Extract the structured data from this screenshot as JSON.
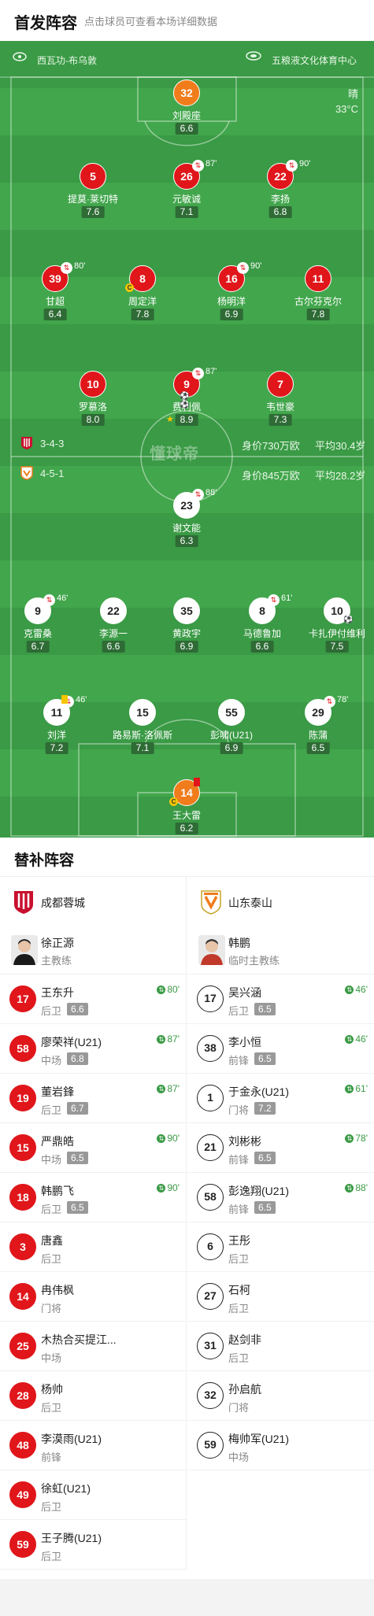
{
  "header": {
    "title": "首发阵容",
    "subtitle": "点击球员可查看本场详细数据"
  },
  "pitch": {
    "home_venue": "西瓦功-布乌敦",
    "away_venue": "五粮液文化体育中心",
    "weather": "晴",
    "temperature": "33°C",
    "watermark": "懂球帝",
    "home_formation": "3-4-3",
    "home_value": "身价730万欧",
    "home_age": "平均30.4岁",
    "away_formation": "4-5-1",
    "away_value": "身价845万欧",
    "away_age": "平均28.2岁"
  },
  "home_lineup": [
    {
      "num": "32",
      "name": "刘殿座",
      "rating": "6.6",
      "color": "o"
    },
    {
      "num": "5",
      "name": "提莫·莱切特",
      "rating": "7.6",
      "color": "r"
    },
    {
      "num": "26",
      "name": "元敏诚",
      "rating": "7.1",
      "color": "r",
      "sub": "87'"
    },
    {
      "num": "22",
      "name": "李扬",
      "rating": "6.8",
      "color": "r",
      "sub": "90'"
    },
    {
      "num": "39",
      "name": "甘超",
      "rating": "6.4",
      "color": "r",
      "sub": "80'"
    },
    {
      "num": "8",
      "name": "周定洋",
      "rating": "7.8",
      "color": "r",
      "captain": "C"
    },
    {
      "num": "16",
      "name": "杨明洋",
      "rating": "6.9",
      "color": "r",
      "sub": "90'"
    },
    {
      "num": "11",
      "name": "古尔芬克尔",
      "rating": "7.8",
      "color": "r"
    },
    {
      "num": "10",
      "name": "罗慕洛",
      "rating": "8.0",
      "color": "r"
    },
    {
      "num": "9",
      "name": "费利佩",
      "rating": "8.9",
      "color": "r",
      "sub": "87'"
    },
    {
      "num": "7",
      "name": "韦世豪",
      "rating": "7.3",
      "color": "r"
    }
  ],
  "away_lineup": [
    {
      "num": "23",
      "name": "谢文能",
      "rating": "6.3",
      "color": "w",
      "sub": "88'"
    },
    {
      "num": "9",
      "name": "克雷桑",
      "rating": "6.7",
      "color": "w",
      "sub": "46'"
    },
    {
      "num": "22",
      "name": "李源一",
      "rating": "6.6",
      "color": "w"
    },
    {
      "num": "35",
      "name": "黄政宇",
      "rating": "6.9",
      "color": "w"
    },
    {
      "num": "8",
      "name": "马德鲁加",
      "rating": "6.6",
      "color": "w",
      "sub": "61'"
    },
    {
      "num": "10",
      "name": "卡扎伊付维利",
      "rating": "7.5",
      "color": "w"
    },
    {
      "num": "11",
      "name": "刘洋",
      "rating": "7.2",
      "color": "w",
      "sub": "46'"
    },
    {
      "num": "15",
      "name": "路易斯·洛佩斯",
      "rating": "7.1",
      "color": "w"
    },
    {
      "num": "55",
      "name": "彭啸(U21)",
      "rating": "6.9",
      "color": "w"
    },
    {
      "num": "29",
      "name": "陈蒲",
      "rating": "6.5",
      "color": "w",
      "sub": "78'"
    },
    {
      "num": "14",
      "name": "王大雷",
      "rating": "6.2",
      "color": "o",
      "captain": "C"
    }
  ],
  "subs_title": "替补阵容",
  "home_team": {
    "name": "成都蓉城",
    "coach_name": "徐正源",
    "coach_role": "主教练",
    "color": "#c8102e"
  },
  "away_team": {
    "name": "山东泰山",
    "coach_name": "韩鹏",
    "coach_role": "临时主教练",
    "color": "#f07c1c"
  },
  "home_subs": [
    {
      "num": "17",
      "name": "王东升",
      "pos": "后卫",
      "rating": "6.6",
      "in": "80'"
    },
    {
      "num": "58",
      "name": "廖荣祥(U21)",
      "pos": "中场",
      "rating": "6.8",
      "in": "87'"
    },
    {
      "num": "19",
      "name": "董岩鋒",
      "pos": "后卫",
      "rating": "6.7",
      "in": "87'"
    },
    {
      "num": "15",
      "name": "严鼎皓",
      "pos": "中场",
      "rating": "6.5",
      "in": "90'"
    },
    {
      "num": "18",
      "name": "韩鹏飞",
      "pos": "后卫",
      "rating": "6.5",
      "in": "90'"
    },
    {
      "num": "3",
      "name": "唐鑫",
      "pos": "后卫"
    },
    {
      "num": "14",
      "name": "冉伟枫",
      "pos": "门将"
    },
    {
      "num": "25",
      "name": "木热合买提江...",
      "pos": "中场"
    },
    {
      "num": "28",
      "name": "杨帅",
      "pos": "后卫"
    },
    {
      "num": "48",
      "name": "李漠雨(U21)",
      "pos": "前锋"
    },
    {
      "num": "49",
      "name": "徐虹(U21)",
      "pos": "后卫"
    },
    {
      "num": "59",
      "name": "王子腾(U21)",
      "pos": "后卫"
    }
  ],
  "away_subs": [
    {
      "num": "17",
      "name": "吴兴涵",
      "pos": "后卫",
      "rating": "6.5",
      "in": "46'"
    },
    {
      "num": "38",
      "name": "李小恒",
      "pos": "前锋",
      "rating": "6.5",
      "in": "46'"
    },
    {
      "num": "1",
      "name": "于金永(U21)",
      "pos": "门将",
      "rating": "7.2",
      "in": "61'"
    },
    {
      "num": "21",
      "name": "刘彬彬",
      "pos": "前锋",
      "rating": "6.5",
      "in": "78'"
    },
    {
      "num": "58",
      "name": "彭逸翔(U21)",
      "pos": "前锋",
      "rating": "6.5",
      "in": "88'"
    },
    {
      "num": "6",
      "name": "王彤",
      "pos": "后卫"
    },
    {
      "num": "27",
      "name": "石柯",
      "pos": "后卫"
    },
    {
      "num": "31",
      "name": "赵剑非",
      "pos": "后卫"
    },
    {
      "num": "32",
      "name": "孙启航",
      "pos": "门将"
    },
    {
      "num": "59",
      "name": "梅帅军(U21)",
      "pos": "中场"
    }
  ]
}
